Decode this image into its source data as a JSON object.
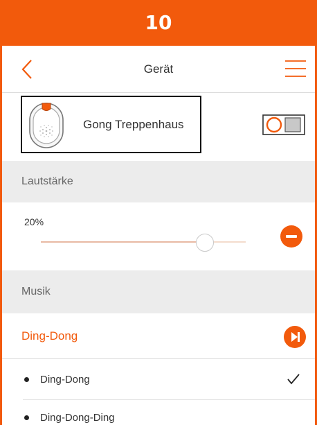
{
  "banner": {
    "number": "10"
  },
  "nav": {
    "title": "Gerät",
    "back_icon": "chevron-left-icon",
    "menu_icon": "hamburger-menu-icon"
  },
  "device": {
    "name": "Gong Treppenhaus",
    "image": "doorbell-gong-icon",
    "toggle_icon": "switch-toggle-icon"
  },
  "volume": {
    "section_label": "Lautstärke",
    "value_label": "20%",
    "level": 0.8
  },
  "music": {
    "section_label": "Musik",
    "current": "Ding-Dong",
    "items": [
      {
        "label": "Ding-Dong",
        "selected": true
      },
      {
        "label": "Ding-Dong-Ding",
        "selected": false
      }
    ]
  },
  "colors": {
    "accent": "#f25a0c",
    "section_bg": "#ececec",
    "text": "#333333"
  }
}
